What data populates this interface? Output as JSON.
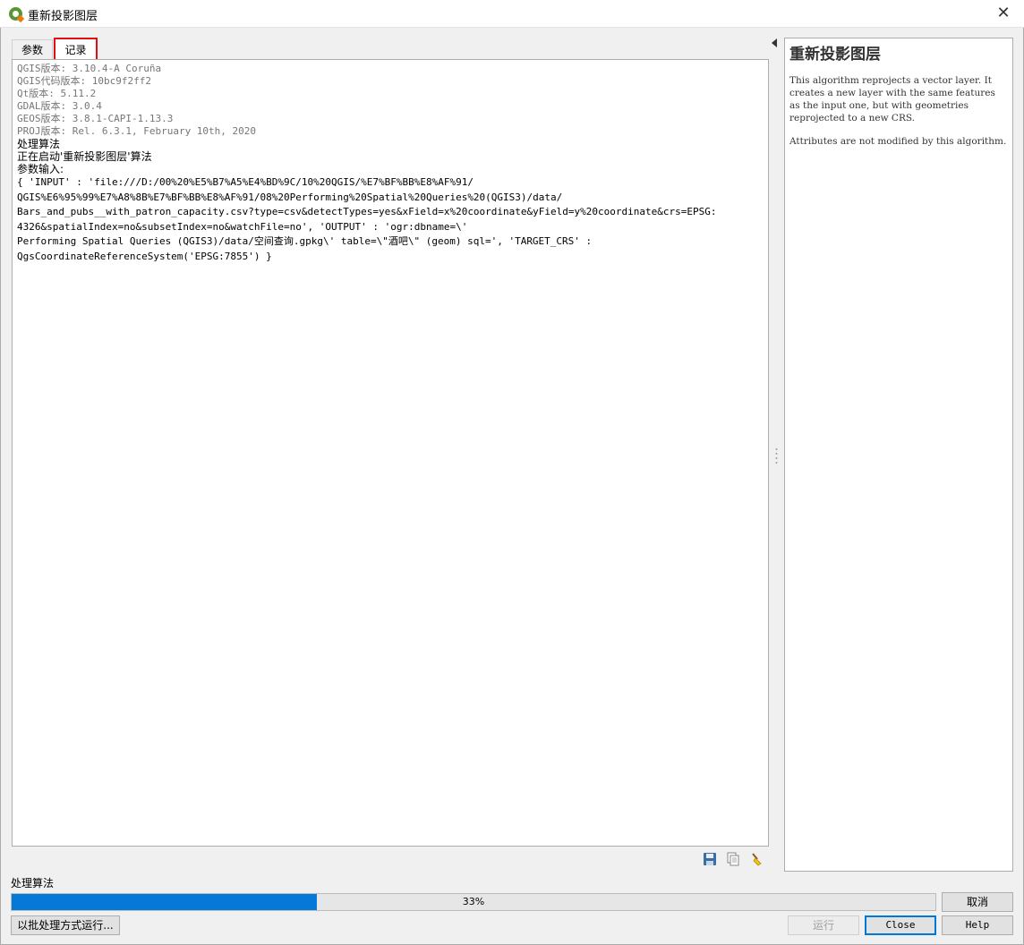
{
  "window": {
    "title": "重新投影图层",
    "close_glyph": "✕"
  },
  "tabs": [
    {
      "label": "参数",
      "active": false
    },
    {
      "label": "记录",
      "active": true
    }
  ],
  "log": {
    "lines": [
      {
        "text": "QGIS版本: 3.10.4-A Coruña",
        "style": "gray"
      },
      {
        "text": "QGIS代码版本: 10bc9f2ff2",
        "style": "gray"
      },
      {
        "text": "Qt版本: 5.11.2",
        "style": "gray"
      },
      {
        "text": "GDAL版本: 3.0.4",
        "style": "gray"
      },
      {
        "text": "GEOS版本: 3.8.1-CAPI-1.13.3",
        "style": "gray"
      },
      {
        "text": "PROJ版本: Rel. 6.3.1, February 10th, 2020",
        "style": "gray"
      },
      {
        "text": "处理算法",
        "style": "black"
      },
      {
        "text": "正在启动'重新投影图层'算法",
        "style": "black"
      },
      {
        "text": "参数输入:",
        "style": "black"
      },
      {
        "text": "{ 'INPUT' : 'file:///D:/00%20%E5%B7%A5%E4%BD%9C/10%20QGIS/%E7%BF%BB%E8%AF%91/",
        "style": "code"
      },
      {
        "text": "QGIS%E6%95%99%E7%A8%8B%E7%BF%BB%E8%AF%91/08%20Performing%20Spatial%20Queries%20(QGIS3)/data/",
        "style": "code"
      },
      {
        "text": "Bars_and_pubs__with_patron_capacity.csv?type=csv&detectTypes=yes&xField=x%20coordinate&yField=y%20coordinate&crs=EPSG:",
        "style": "code"
      },
      {
        "text": "4326&spatialIndex=no&subsetIndex=no&watchFile=no', 'OUTPUT' : 'ogr:dbname=\\'",
        "style": "code"
      },
      {
        "text": "Performing Spatial Queries (QGIS3)/data/空间查询.gpkg\\' table=\\\"酒吧\\\" (geom) sql=', 'TARGET_CRS' :",
        "style": "code"
      },
      {
        "text": "QgsCoordinateReferenceSystem('EPSG:7855') }",
        "style": "code"
      }
    ]
  },
  "log_tools": {
    "save_icon": "save-icon",
    "copy_icon": "copy-icon",
    "clear_icon": "clear-icon"
  },
  "help": {
    "title": "重新投影图层",
    "paragraph1": "This algorithm reprojects a vector layer. It creates a new layer with the same features as the input one, but with geometries reprojected to a new CRS.",
    "paragraph2": "Attributes are not modified by this algorithm."
  },
  "progress": {
    "label": "处理算法",
    "value": 0.33,
    "text": "33%"
  },
  "buttons": {
    "cancel": "取消",
    "batch": "以批处理方式运行...",
    "run": "运行",
    "close": "Close",
    "help": "Help"
  },
  "colors": {
    "progress_fill": "#0678d7",
    "active_tab_highlight": "#e01010",
    "close_focus": "#0078d7"
  }
}
